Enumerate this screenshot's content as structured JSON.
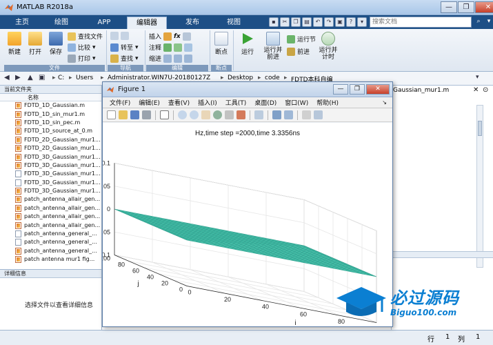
{
  "window": {
    "title": "MATLAB R2018a",
    "controls": [
      "—",
      "❐",
      "✕"
    ]
  },
  "tabs": [
    "主页",
    "绘图",
    "APP",
    "编辑器",
    "发布",
    "视图"
  ],
  "active_tab": "编辑器",
  "search": {
    "placeholder": "搜索文档"
  },
  "ribbon": {
    "file_group": {
      "label": "文件",
      "new": "新建",
      "open": "打开",
      "save": "保存",
      "find_files": "查找文件",
      "compare": "比较",
      "print": "打印"
    },
    "nav_group": {
      "label": "导航",
      "goto": "转至",
      "find": "查找"
    },
    "edit_group": {
      "label": "编辑",
      "insert": "插入",
      "comment": "注释",
      "indent": "缩进",
      "fx": "fx"
    },
    "breakpoint_group": {
      "label": "断点",
      "breakpoints": "断点"
    },
    "run_group": {
      "run": "运行",
      "run_advance": "运行并\n前进",
      "run_section": "运行节",
      "advance": "前进",
      "run_time": "运行并\n计时"
    }
  },
  "path": [
    "C:",
    "Users",
    "Administrator.WIN7U-20180127Z",
    "Desktop",
    "code",
    "FDTD本科自编"
  ],
  "current_folder": {
    "title": "当前文件夹",
    "column": "名称",
    "files": [
      {
        "name": "FDTD_1D_Gaussian.m",
        "type": "m"
      },
      {
        "name": "FDTD_1D_sin_mur1.m",
        "type": "m"
      },
      {
        "name": "FDTD_1D_sin_pec.m",
        "type": "m"
      },
      {
        "name": "FDTD_1D_source_at_0.m",
        "type": "m"
      },
      {
        "name": "FDTD_2D_Gaussian_mur1...",
        "type": "m"
      },
      {
        "name": "FDTD_2D_Gaussian_mur1...",
        "type": "m"
      },
      {
        "name": "FDTD_3D_Gaussian_mur1...",
        "type": "m"
      },
      {
        "name": "FDTD_3D_Gaussian_mur1...",
        "type": "m"
      },
      {
        "name": "FDTD_3D_Gaussian_mur1...",
        "type": "doc"
      },
      {
        "name": "FDTD_3D_Gaussian_mur1...",
        "type": "doc"
      },
      {
        "name": "FDTD_3D_Gaussian_mur1...",
        "type": "m"
      },
      {
        "name": "patch_antenna_allair_gen...",
        "type": "m"
      },
      {
        "name": "patch_antenna_allair_gen...",
        "type": "m"
      },
      {
        "name": "patch_antenna_allair_gen...",
        "type": "m"
      },
      {
        "name": "patch_antenna_allair_gen...",
        "type": "m"
      },
      {
        "name": "patch_antenna_general_...",
        "type": "doc"
      },
      {
        "name": "patch_antenna_general_...",
        "type": "doc"
      },
      {
        "name": "patch_antenna_general_...",
        "type": "m"
      },
      {
        "name": "patch antenna mur1 fig...",
        "type": "m"
      }
    ]
  },
  "details": {
    "title": "详细信息",
    "message": "选择文件以查看详细信息"
  },
  "editor_tab_fragment": "Gaussian_mur1.m",
  "statusbar": {
    "row_label": "行",
    "row_value": "1",
    "col_label": "列",
    "col_value": "1"
  },
  "figure": {
    "title": "Figure 1",
    "menu": [
      "文件(F)",
      "编辑(E)",
      "查看(V)",
      "插入(I)",
      "工具(T)",
      "桌面(D)",
      "窗口(W)",
      "帮助(H)"
    ]
  },
  "chart_data": {
    "type": "surface",
    "title": "Hz,time step =2000,time 3.3356ns",
    "xlabel": "i",
    "ylabel": "j",
    "zlabel": "Hz",
    "xlim": [
      0,
      100
    ],
    "ylim": [
      0,
      100
    ],
    "zlim": [
      -0.1,
      0.1
    ],
    "x_ticks": [
      0,
      20,
      40,
      60,
      80,
      100
    ],
    "y_ticks": [
      0,
      20,
      40,
      60,
      80,
      100
    ],
    "z_ticks": [
      -0.1,
      -0.05,
      0,
      0.05,
      0.1
    ],
    "surface_value": 0,
    "surface_color": "#3fbfa8"
  },
  "watermark": {
    "brand": "必过源码",
    "url": "Biguo100.com"
  }
}
